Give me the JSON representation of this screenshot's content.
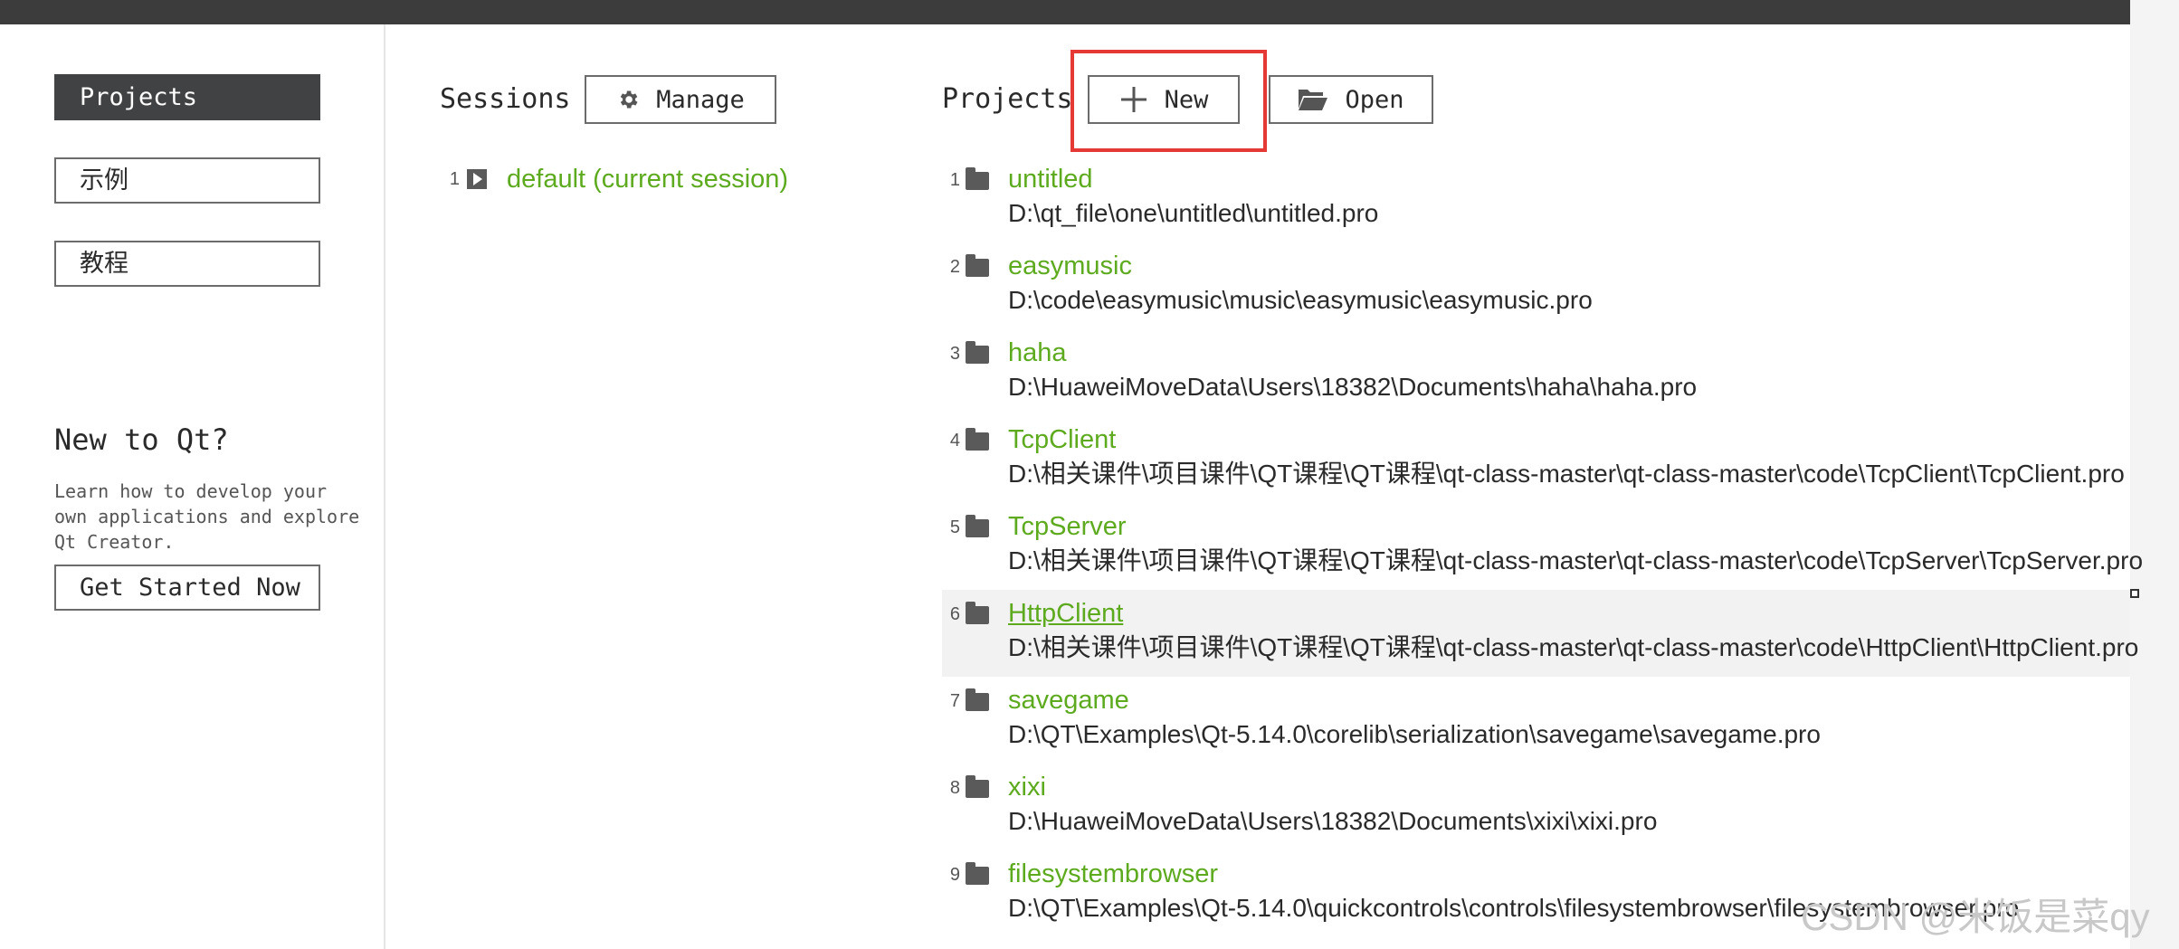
{
  "sidebar": {
    "tabs": [
      {
        "label": "Projects",
        "active": true
      },
      {
        "label": "示例",
        "active": false
      },
      {
        "label": "教程",
        "active": false
      }
    ],
    "new_to_qt_title": "New to Qt?",
    "new_to_qt_desc": "Learn how to develop your own applications and explore Qt Creator.",
    "get_started_label": "Get Started Now"
  },
  "sessions": {
    "label": "Sessions",
    "manage_label": "Manage",
    "items": [
      {
        "num": "1",
        "name": "default (current session)"
      }
    ]
  },
  "projects": {
    "label": "Projects",
    "new_label": "New",
    "open_label": "Open",
    "items": [
      {
        "num": "1",
        "name": "untitled",
        "path": "D:\\qt_file\\one\\untitled\\untitled.pro"
      },
      {
        "num": "2",
        "name": "easymusic",
        "path": "D:\\code\\easymusic\\music\\easymusic\\easymusic.pro"
      },
      {
        "num": "3",
        "name": "haha",
        "path": "D:\\HuaweiMoveData\\Users\\18382\\Documents\\haha\\haha.pro"
      },
      {
        "num": "4",
        "name": "TcpClient",
        "path": "D:\\相关课件\\项目课件\\QT课程\\QT课程\\qt-class-master\\qt-class-master\\code\\TcpClient\\TcpClient.pro"
      },
      {
        "num": "5",
        "name": "TcpServer",
        "path": "D:\\相关课件\\项目课件\\QT课程\\QT课程\\qt-class-master\\qt-class-master\\code\\TcpServer\\TcpServer.pro"
      },
      {
        "num": "6",
        "name": "HttpClient",
        "path": "D:\\相关课件\\项目课件\\QT课程\\QT课程\\qt-class-master\\qt-class-master\\code\\HttpClient\\HttpClient.pro"
      },
      {
        "num": "7",
        "name": "savegame",
        "path": "D:\\QT\\Examples\\Qt-5.14.0\\corelib\\serialization\\savegame\\savegame.pro"
      },
      {
        "num": "8",
        "name": "xixi",
        "path": "D:\\HuaweiMoveData\\Users\\18382\\Documents\\xixi\\xixi.pro"
      },
      {
        "num": "9",
        "name": "filesystembrowser",
        "path": "D:\\QT\\Examples\\Qt-5.14.0\\quickcontrols\\controls\\filesystembrowser\\filesystembrowser.pro"
      }
    ]
  },
  "watermark": "CSDN @米饭是菜qy",
  "colors": {
    "accent_green": "#5daa1e",
    "highlight_red": "#e53935",
    "topbar": "#3c3c3c"
  }
}
